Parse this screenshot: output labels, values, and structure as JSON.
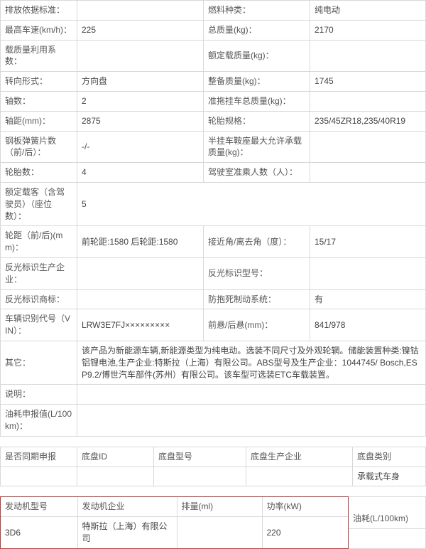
{
  "spec": {
    "row1": {
      "l1": "排放依据标准：",
      "v1": "",
      "l2": "燃料种类：",
      "v2": "纯电动"
    },
    "row2": {
      "l1": "最高车速(km/h)：",
      "v1": "225",
      "l2": "总质量(kg)：",
      "v2": "2170"
    },
    "row3": {
      "l1": "载质量利用系数：",
      "v1": "",
      "l2": "额定载质量(kg)：",
      "v2": ""
    },
    "row4": {
      "l1": "转向形式：",
      "v1": "方向盘",
      "l2": "整备质量(kg)：",
      "v2": "1745"
    },
    "row5": {
      "l1": "轴数：",
      "v1": "2",
      "l2": "准拖挂车总质量(kg)：",
      "v2": ""
    },
    "row6": {
      "l1": "轴距(mm)：",
      "v1": "2875",
      "l2": "轮胎规格：",
      "v2": "235/45ZR18,235/40R19"
    },
    "row7": {
      "l1": "钢板弹簧片数（前/后）：",
      "v1": "-/-",
      "l2": "半挂车鞍座最大允许承载质量(kg)：",
      "v2": ""
    },
    "row8": {
      "l1": "轮胎数：",
      "v1": "4",
      "l2": "驾驶室准乘人数（人）：",
      "v2": ""
    },
    "row9": {
      "l1": "额定载客（含驾驶员）（座位数）：",
      "v1": "5",
      "l2": "",
      "v2": ""
    },
    "row10": {
      "l1": "轮距（前/后)(mm)：",
      "v1": "前轮距:1580 后轮距:1580",
      "l2": "接近角/离去角（度）：",
      "v2": "15/17"
    },
    "row11": {
      "l1": "反光标识生产企业：",
      "v1": "",
      "l2": "反光标识型号：",
      "v2": ""
    },
    "row12": {
      "l1": "反光标识商标：",
      "v1": "",
      "l2": "防抱死制动系统：",
      "v2": "有"
    },
    "row13": {
      "l1": "车辆识别代号（VIN）：",
      "v1": "LRW3E7FJ×××××××××",
      "l2": "前悬/后悬(mm)：",
      "v2": "841/978"
    },
    "row14": {
      "l1": "其它：",
      "v1": "该产品为新能源车辆,新能源类型为纯电动。选装不同尺寸及外观轮辋。储能装置种类:镍钴铝锂电池,生产企业:特斯拉（上海）有限公司。ABS型号及生产企业：1044745/ Bosch,ESP9.2/博世汽车部件(苏州）有限公司。该车型可选装ETC车载装置。"
    },
    "row15": {
      "l1": "说明：",
      "v1": ""
    },
    "row16": {
      "l1": "油耗申报值(L/100km)：",
      "v1": ""
    }
  },
  "chassis": {
    "h0": "是否同期申报",
    "h1": "底盘ID",
    "h2": "底盘型号",
    "h3": "底盘生产企业",
    "h4": "底盘类别",
    "v4": "承载式车身"
  },
  "engine": {
    "h0": "发动机型号",
    "h1": "发动机企业",
    "h2": "排量(ml)",
    "h3": "功率(kW)",
    "h4": "油耗(L/100km)",
    "v0": "3D6",
    "v1": "特斯拉（上海）有限公司",
    "v2": "",
    "v3": "220",
    "v4": ""
  }
}
